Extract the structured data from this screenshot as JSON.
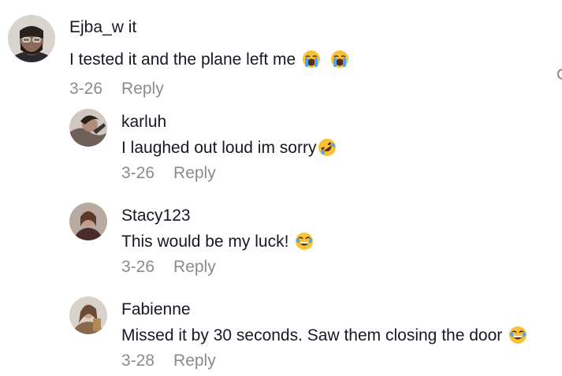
{
  "comments": [
    {
      "username": "Ejba_w it",
      "text": "I tested it and the plane left me",
      "emojis": [
        "loudly-crying-face",
        "loudly-crying-face"
      ],
      "date": "3-26",
      "reply_label": "Reply"
    },
    {
      "username": "karluh",
      "text": "I laughed out loud im sorry",
      "emojis": [
        "rolling-on-floor-laughing"
      ],
      "date": "3-26",
      "reply_label": "Reply"
    },
    {
      "username": "Stacy123",
      "text": "This would be my luck!",
      "emojis": [
        "face-with-tears-of-joy"
      ],
      "date": "3-26",
      "reply_label": "Reply"
    },
    {
      "username": "Fabienne",
      "text": "Missed it by 30 seconds. Saw them closing the door",
      "emojis": [
        "face-with-tears-of-joy"
      ],
      "date": "3-28",
      "reply_label": "Reply"
    }
  ],
  "colors": {
    "text": "#161823",
    "muted": "#8a8b91",
    "background": "#ffffff"
  },
  "icons": {
    "edge": "like-heart-icon"
  }
}
